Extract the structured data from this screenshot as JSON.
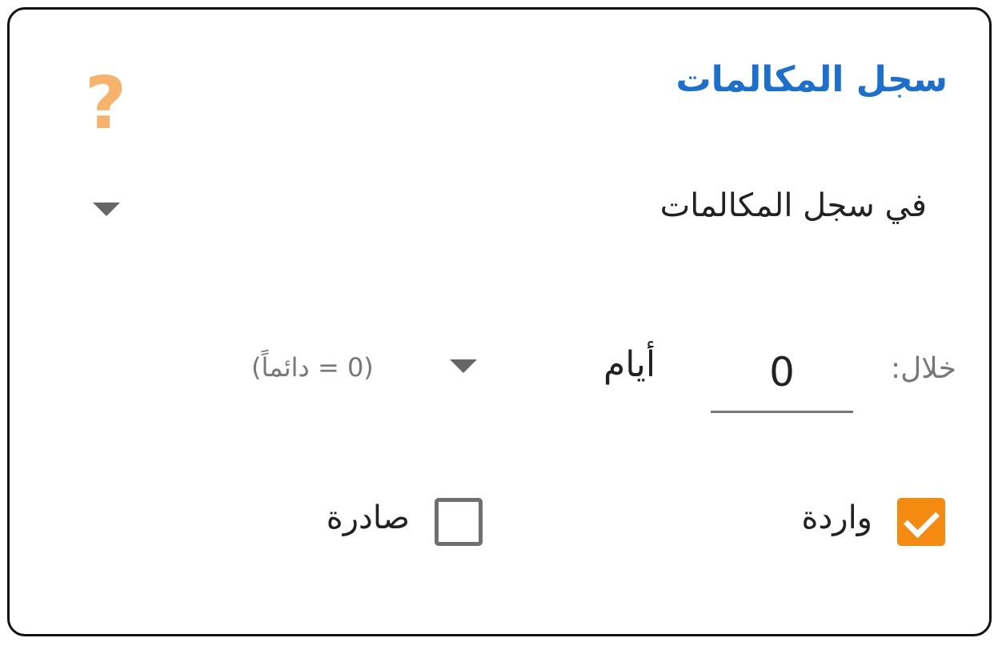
{
  "title": "سجل المكالمات",
  "help_icon": "question-mark-icon",
  "source_select": {
    "value": "في سجل المكالمات",
    "icon": "dropdown-caret-icon"
  },
  "period": {
    "label": "خلال:",
    "value": "0",
    "unit": "أيام",
    "unit_icon": "dropdown-caret-icon",
    "hint": "(0 = دائماً)"
  },
  "checkboxes": [
    {
      "label": "واردة",
      "checked": true
    },
    {
      "label": "صادرة",
      "checked": false
    }
  ],
  "colors": {
    "title": "#1a6fcf",
    "help_icon": "#f7b26b",
    "checkbox_checked": "#f58a10",
    "checkbox_unchecked_border": "#707070"
  }
}
